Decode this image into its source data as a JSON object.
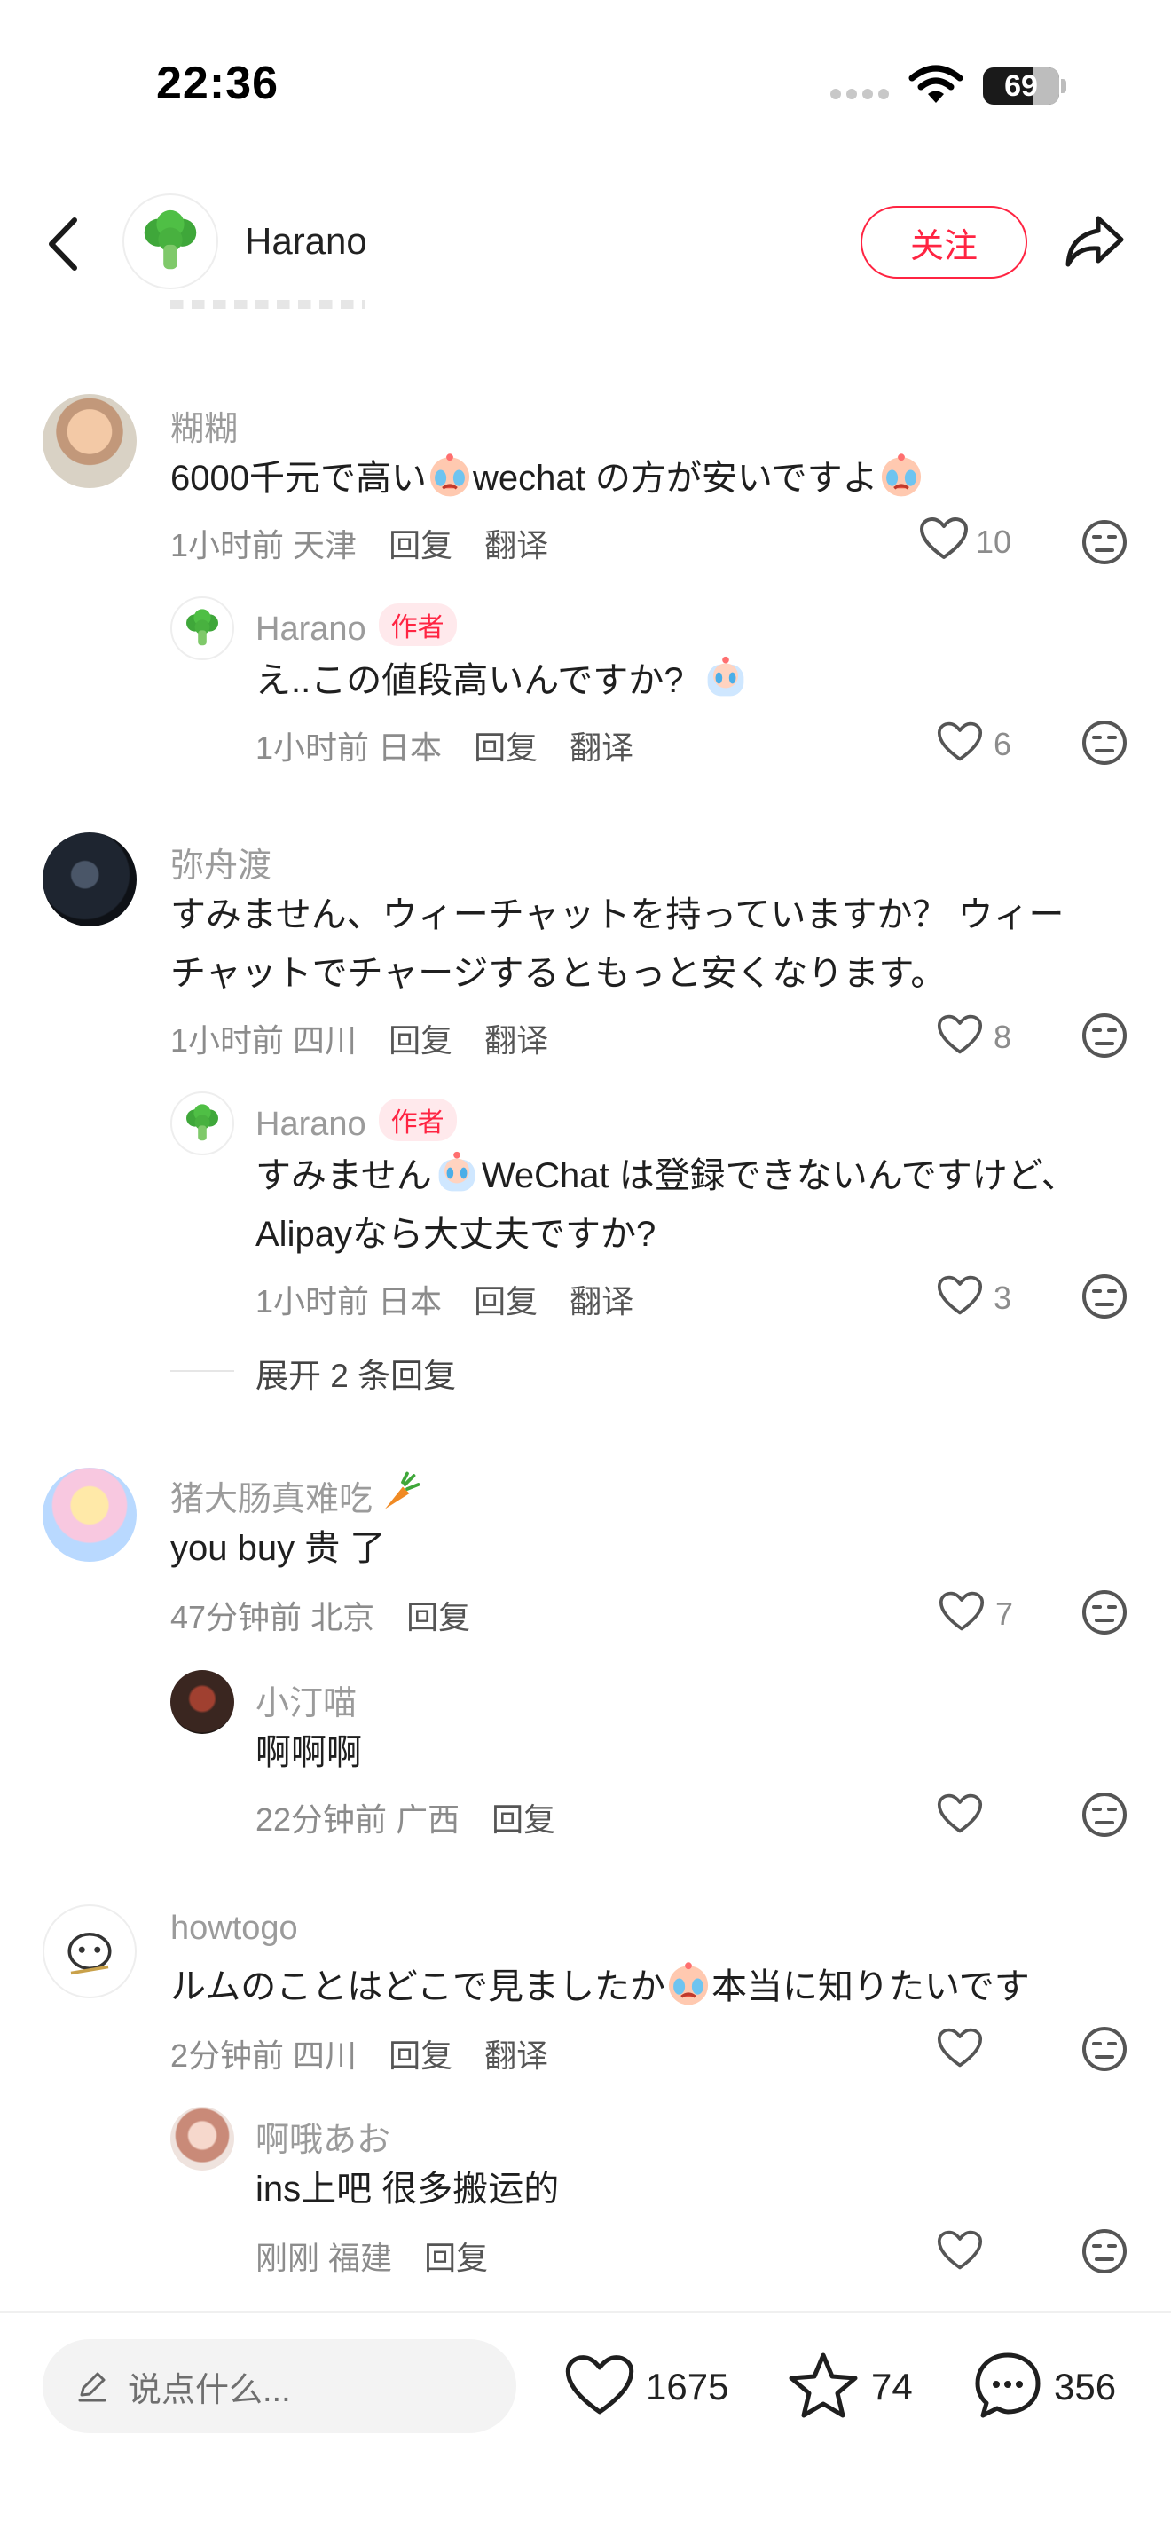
{
  "status_bar": {
    "time": "22:36",
    "battery": "69"
  },
  "header": {
    "author_name": "Harano",
    "follow_label": "关注"
  },
  "comments": [
    {
      "user": "糊糊",
      "text_1": "6000千元で高い",
      "text_2": "wechat の方が安いですよ",
      "time": "1小时前",
      "location": "天津",
      "reply": "回复",
      "translate": "翻译",
      "likes": "10",
      "replies": [
        {
          "user": "Harano",
          "tag": "作者",
          "text": "え..この値段高いんですか?",
          "time": "1小时前",
          "location": "日本",
          "reply": "回复",
          "translate": "翻译",
          "likes": "6"
        }
      ]
    },
    {
      "user": "弥舟渡",
      "text_1": "すみません、ウィーチャットを持っていますか？ ウィー",
      "text_2": "チャットでチャージするともっと安くなります。",
      "time": "1小时前",
      "location": "四川",
      "reply": "回复",
      "translate": "翻译",
      "likes": "8",
      "replies": [
        {
          "user": "Harano",
          "tag": "作者",
          "text_1": "すみません",
          "text_2": "WeChat は登録できないんですけど、",
          "text_3": "Alipayなら大丈夫ですか?",
          "time": "1小时前",
          "location": "日本",
          "reply": "回复",
          "translate": "翻译",
          "likes": "3"
        }
      ],
      "expand": "展开 2 条回复"
    },
    {
      "user": "猪大肠真难吃",
      "text": "you buy 贵 了",
      "time": "47分钟前",
      "location": "北京",
      "reply": "回复",
      "likes": "7",
      "replies": [
        {
          "user": "小汀喵",
          "text": "啊啊啊",
          "time": "22分钟前",
          "location": "广西",
          "reply": "回复"
        }
      ]
    },
    {
      "user": "howtogo",
      "text_1": "ルムのことはどこで見ましたか",
      "text_2": "本当に知りたいです",
      "time": "2分钟前",
      "location": "四川",
      "reply": "回复",
      "translate": "翻译",
      "replies": [
        {
          "user": "啊哦あお",
          "text": "ins上吧 很多搬运的",
          "time": "刚刚",
          "location": "福建",
          "reply": "回复"
        }
      ]
    }
  ],
  "bottom_bar": {
    "input_placeholder": "说点什么...",
    "likes": "1675",
    "stars": "74",
    "comments": "356"
  },
  "colors": {
    "accent": "#ff2442",
    "secondary_text": "#8c8c8c",
    "input_bg": "#f3f3f3"
  }
}
